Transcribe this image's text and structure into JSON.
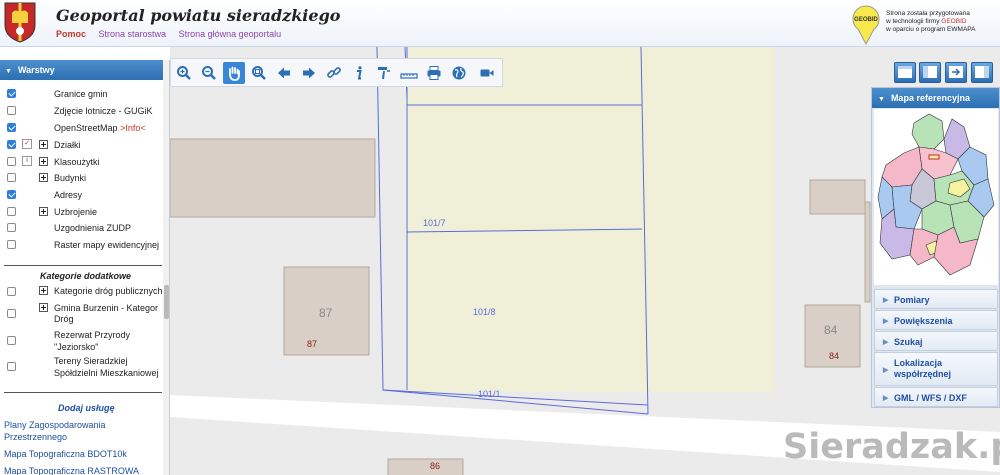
{
  "header": {
    "title": "Geoportal powiatu sieradzkiego",
    "nav": [
      "Pomoc",
      "Strona starostwa",
      "Strona główna geoportalu"
    ],
    "logo_text": "GEOBID",
    "credits": [
      "Strona została przygotowana",
      "w technologii firmy",
      "GEOBID",
      "w oparciu o program EWMAPA"
    ]
  },
  "layers": {
    "title": "Warstwy",
    "items": [
      {
        "label": "Granice gmin",
        "checked": true
      },
      {
        "label": "Zdjęcie lotnicze - GUGiK",
        "checked": false
      },
      {
        "label": "OpenStreetMap",
        "info": ">Info<",
        "checked": true
      },
      {
        "label": "Działki",
        "checked": true
      },
      {
        "label": "Klasoużytki",
        "checked": false
      },
      {
        "label": "Budynki",
        "checked": false
      },
      {
        "label": "Adresy",
        "checked": true
      },
      {
        "label": "Uzbrojenie",
        "checked": false
      },
      {
        "label": "Uzgodnienia ZUDP",
        "checked": false
      },
      {
        "label": "Raster mapy ewidencyjnej",
        "checked": false
      }
    ],
    "extra_title": "Kategorie dodatkowe",
    "extra_items": [
      {
        "label": "Kategorie dróg publicznych",
        "checked": false
      },
      {
        "label_lines": [
          "Gmina Burzenin - Kategor",
          "Dróg"
        ],
        "checked": false
      },
      {
        "label_lines": [
          "Rezerwat Przyrody",
          "\"Jeziorsko\""
        ],
        "checked": false
      },
      {
        "label_lines": [
          "Tereny Sieradzkiej",
          "Spółdzielni Mieszkaniowej"
        ],
        "checked": false
      }
    ],
    "add_service_title": "Dodaj usługę",
    "services": [
      [
        "Plany Zagospodarowania",
        "Przestrzennego"
      ],
      [
        "Mapa Topograficzna BDOT10k"
      ],
      [
        "Mapa Topograficzna RASTROWA"
      ]
    ]
  },
  "toolbar": {
    "tools": [
      "zoom-in",
      "zoom-out",
      "pan",
      "zoom-box",
      "back",
      "forward",
      "link",
      "info",
      "query",
      "measure",
      "print",
      "globe",
      "camera"
    ],
    "active": "pan"
  },
  "map": {
    "parcels": [
      "101/7",
      "101/8",
      "101/1"
    ],
    "buildings": [
      {
        "number": "87",
        "address": "87"
      },
      {
        "number": "84",
        "address": "84"
      },
      {
        "address": "86"
      }
    ],
    "colors": {
      "parcel_fill": "#f0f0d8",
      "parcel_line": "#5b6bdc",
      "building_fill": "#d9cfc6",
      "building_line": "#b5a89c",
      "road": "#ffffff"
    }
  },
  "right_panel": {
    "reference_title": "Mapa referencyjna",
    "sections": [
      "Pomiary",
      "Powiększenia",
      "Szukaj",
      "Lokalizacja współrzędnej",
      "GML / WFS / DXF"
    ]
  },
  "watermark": "Sieradzak.pl"
}
